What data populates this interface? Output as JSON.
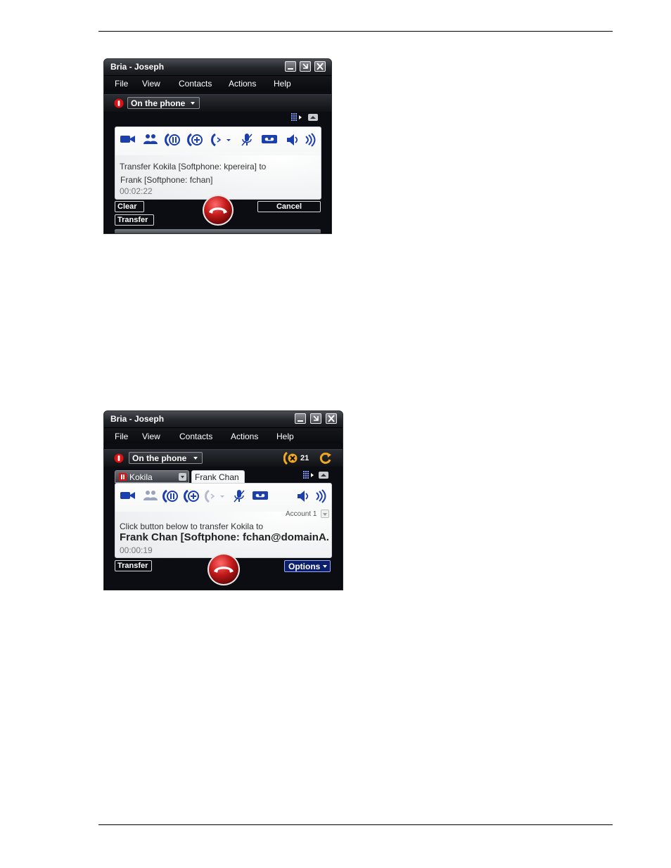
{
  "screen1": {
    "title": "Bria - Joseph",
    "menu": [
      "File",
      "View",
      "Contacts",
      "Actions",
      "Help"
    ],
    "presence": "On the phone",
    "transfer_line1": "Transfer Kokila [Softphone: kpereira] to",
    "transfer_line2": "Frank [Softphone: fchan]",
    "timer": "00:02:22",
    "buttons": {
      "clear": "Clear",
      "cancel": "Cancel",
      "transfer": "Transfer"
    },
    "icons": [
      "video-icon",
      "contacts-group-icon",
      "hold-icon",
      "add-call-icon",
      "transfer-dropdown-icon",
      "microphone-icon",
      "voicemail-icon",
      "speaker-icon",
      "volume-icon",
      "dialpad-icon",
      "collapse-icon",
      "hangup-icon"
    ]
  },
  "screen2": {
    "title": "Bria - Joseph",
    "menu": [
      "File",
      "View",
      "Contacts",
      "Actions",
      "Help"
    ],
    "presence": "On the phone",
    "missed_count": "21",
    "tabs": [
      "Kokila",
      "Frank Chan"
    ],
    "account": "Account 1",
    "instruction": "Click button below to transfer Kokila to",
    "target": "Frank Chan [Softphone: fchan@domainA.",
    "timer": "00:00:19",
    "buttons": {
      "transfer": "Transfer",
      "options": "Options"
    },
    "colors": {
      "accent_orange": "#f0a81e",
      "hangup_red": "#c41a1a",
      "options_blue": "#0c1f6a"
    }
  }
}
